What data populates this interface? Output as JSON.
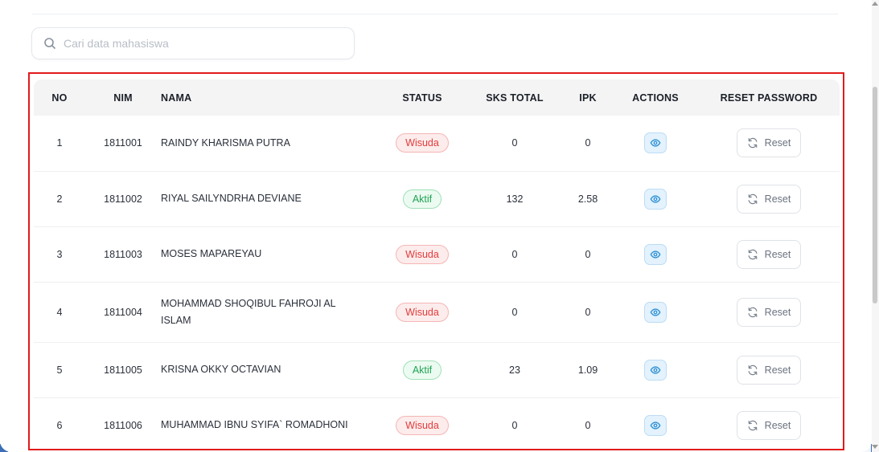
{
  "search": {
    "placeholder": "Cari data mahasiswa",
    "value": ""
  },
  "table": {
    "headers": {
      "no": "NO",
      "nim": "NIM",
      "nama": "NAMA",
      "status": "STATUS",
      "sks_total": "SKS TOTAL",
      "ipk": "IPK",
      "actions": "ACTIONS",
      "reset_password": "RESET PASSWORD"
    },
    "rows": [
      {
        "no": "1",
        "nim": "1811001",
        "nama": "RAINDY KHARISMA PUTRA",
        "status": "Wisuda",
        "sks_total": "0",
        "ipk": "0",
        "reset_label": "Reset"
      },
      {
        "no": "2",
        "nim": "1811002",
        "nama": "RIYAL SAILYNDRHA DEVIANE",
        "status": "Aktif",
        "sks_total": "132",
        "ipk": "2.58",
        "reset_label": "Reset"
      },
      {
        "no": "3",
        "nim": "1811003",
        "nama": "MOSES MAPAREYAU",
        "status": "Wisuda",
        "sks_total": "0",
        "ipk": "0",
        "reset_label": "Reset"
      },
      {
        "no": "4",
        "nim": "1811004",
        "nama": "MOHAMMAD SHOQIBUL FAHROJI AL ISLAM",
        "status": "Wisuda",
        "sks_total": "0",
        "ipk": "0",
        "reset_label": "Reset"
      },
      {
        "no": "5",
        "nim": "1811005",
        "nama": "KRISNA OKKY OCTAVIAN",
        "status": "Aktif",
        "sks_total": "23",
        "ipk": "1.09",
        "reset_label": "Reset"
      },
      {
        "no": "6",
        "nim": "1811006",
        "nama": "MUHAMMAD IBNU SYIFA` ROMADHONI",
        "status": "Wisuda",
        "sks_total": "0",
        "ipk": "0",
        "reset_label": "Reset"
      }
    ]
  },
  "icons": {
    "search": "search-icon",
    "view": "eye-icon",
    "reset": "refresh-icon"
  },
  "colors": {
    "highlight_border": "#e01b1b",
    "status_wisuda": "#e23b3b",
    "status_aktif": "#1fa354",
    "view_button_bg": "#e3f2fd"
  }
}
